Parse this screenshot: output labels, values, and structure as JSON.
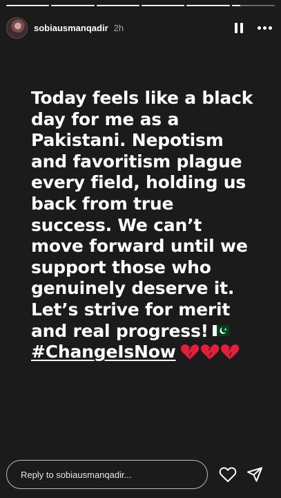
{
  "progress": {
    "segments": [
      1,
      1,
      1,
      1,
      1,
      0.2
    ]
  },
  "header": {
    "username": "sobiausmanqadir",
    "time": "2h",
    "avatar_icon": "user-avatar",
    "pause_icon": "pause-icon",
    "more_icon": "more-options-icon"
  },
  "story": {
    "lines": [
      "Today feels like a black",
      "day for me as a",
      "Pakistani. Nepotism",
      "and favoritism plague",
      "every field, holding us",
      "back from true",
      "success. We can’t",
      "move forward until we",
      "support those who",
      "genuinely deserve it.",
      "Let’s strive for merit",
      "and real progress!"
    ],
    "flag_emoji": "🇵🇰",
    "hashtag": "#ChangeIsNow",
    "broken_hearts": "💔💔💔",
    "colors": {
      "background": "#1b1b1b",
      "text": "#ffffff",
      "flag_green": "#01411c",
      "heart_red": "#e0203a"
    }
  },
  "footer": {
    "reply_placeholder": "Reply to sobiausmanqadir...",
    "like_icon": "heart-outline-icon",
    "share_icon": "send-icon"
  }
}
